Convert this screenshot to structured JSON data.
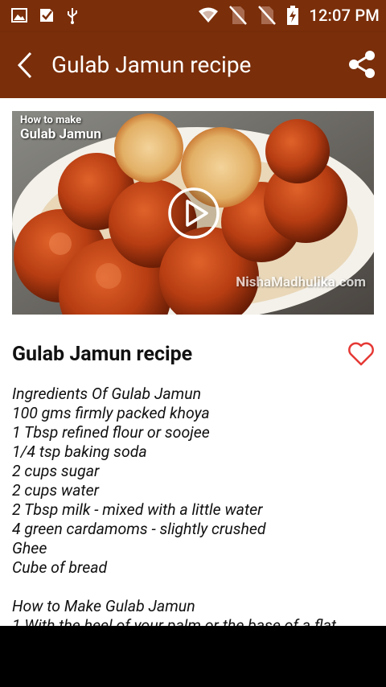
{
  "status_bar": {
    "time": "12:07 PM",
    "left_icons": [
      "image-icon",
      "checkbox-icon",
      "usb-icon"
    ],
    "right_icons": [
      "wifi-icon",
      "no-sim-icon",
      "no-sim-icon-2",
      "battery-charging-icon"
    ]
  },
  "app_bar": {
    "title": "Gulab Jamun recipe",
    "back_icon": "back-arrow-icon",
    "share_icon": "share-icon",
    "color": "#7a2e0a"
  },
  "video": {
    "caption_small": "How to make",
    "caption_big": "Gulab Jamun",
    "watermark": "NishaMadhulika.com",
    "play_icon": "play-icon"
  },
  "recipe": {
    "title": "Gulab Jamun recipe",
    "favorite_icon": "heart-outline-icon",
    "accent": "#e53935",
    "lines": [
      "Ingredients Of Gulab Jamun",
      "100 gms firmly packed khoya",
      "1 Tbsp refined flour or soojee",
      "1/4 tsp baking soda",
      "2 cups sugar",
      "2 cups water",
      "2 Tbsp milk - mixed with a little water",
      "4 green cardamoms - slightly crushed",
      "Ghee",
      "Cube of bread",
      "",
      "How to Make Gulab Jamun",
      "1 With the heel of your palm or the base of a flat"
    ]
  }
}
